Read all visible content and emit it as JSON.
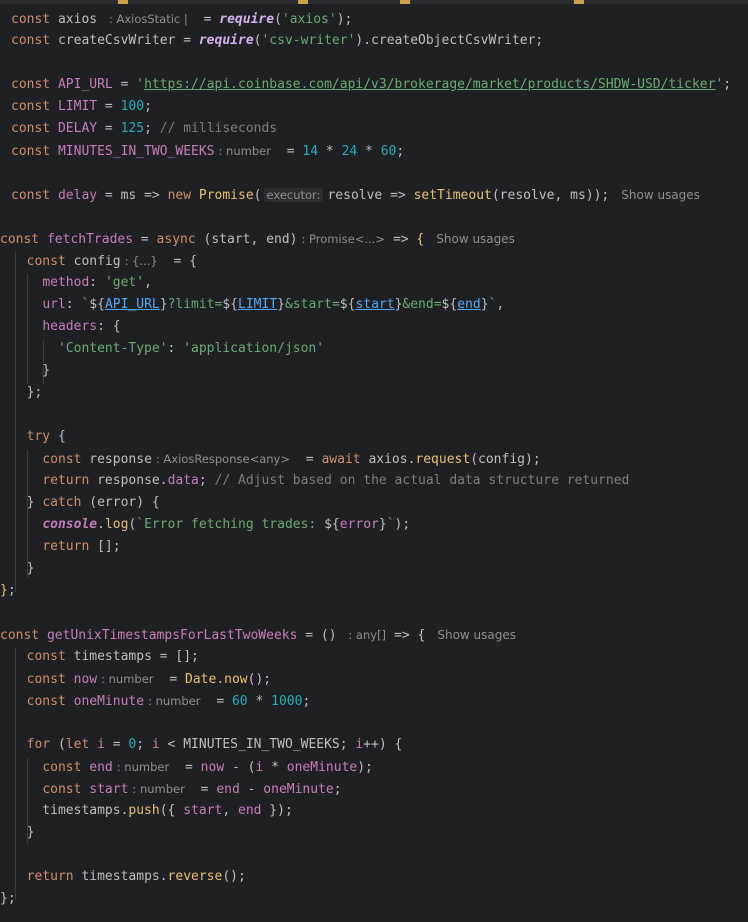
{
  "editor": {
    "hints": {
      "axios_type": ": AxiosStatic |",
      "minutes_type": ": number",
      "executor": "executor:",
      "promise_type": ": Promise<...>",
      "config_type": ": {...}",
      "response_type": ": AxiosResponse<any>",
      "any_array": ": any[]",
      "number": ": number",
      "show_usages": "Show usages"
    },
    "strings": {
      "axios": "'axios'",
      "csv_writer": "'csv-writer'",
      "api_url": "https://api.coinbase.com/api/v3/brokerage/market/products/SHDW-USD/ticker",
      "get": "'get'",
      "content_type_key": "'Content-Type'",
      "content_type_val": "'application/json'",
      "comment_ms": "// milliseconds",
      "comment_adjust": "// Adjust based on the actual data structure returned",
      "error_msg": "`Error fetching trades: ",
      "limit": "100",
      "delay": "125",
      "n14": "14",
      "n24": "24",
      "n60": "60",
      "n60b": "60",
      "n1000": "1000",
      "n0": "0"
    }
  }
}
